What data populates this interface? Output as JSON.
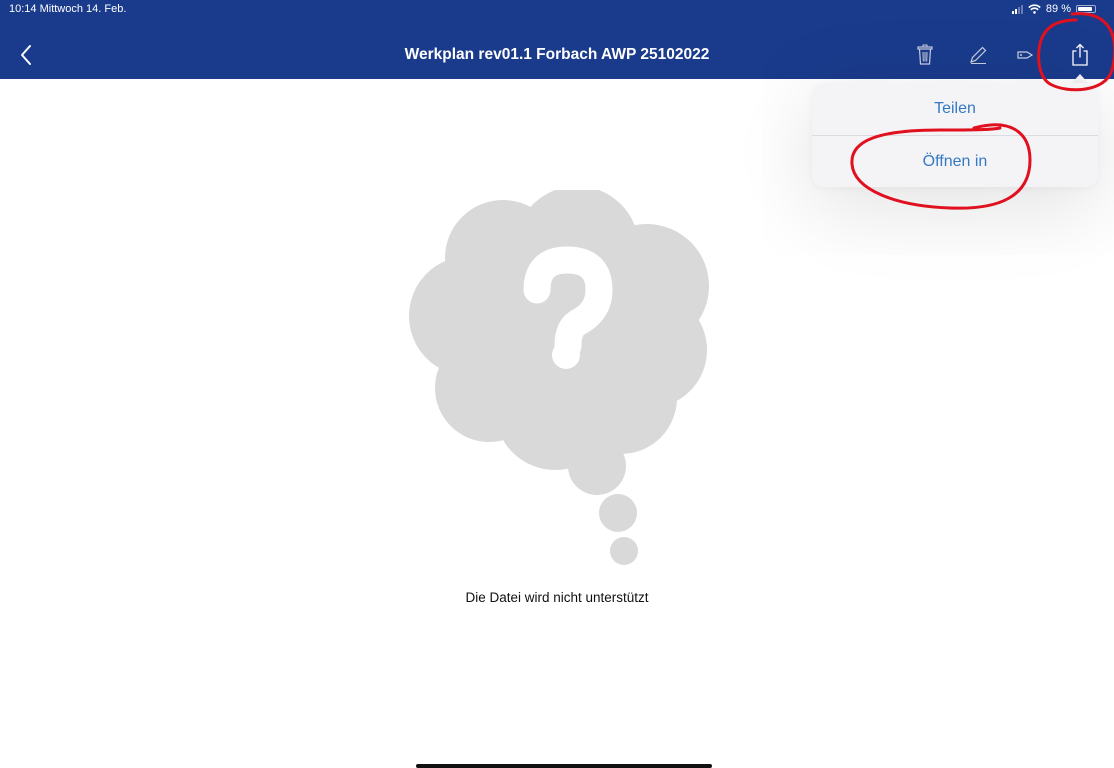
{
  "status_bar": {
    "time_date": "10:14  Mittwoch 14. Feb.",
    "battery": "89 %"
  },
  "nav_bar": {
    "title": "Werkplan rev01.1 Forbach AWP 25102022",
    "back_icon": "chevron-left-icon",
    "actions": [
      "trash-icon",
      "pencil-icon",
      "tag-icon",
      "share-icon"
    ]
  },
  "share_menu": {
    "items": [
      {
        "label": "Teilen"
      },
      {
        "label": "Öffnen in"
      }
    ]
  },
  "content": {
    "message": "Die Datei wird nicht unterstützt",
    "illustration": "question-cloud-icon"
  },
  "colors": {
    "nav_background": "#1a3b8c",
    "menu_text": "#3478c6",
    "illustration": "#d9d9d9",
    "annotation": "#e0101e"
  }
}
